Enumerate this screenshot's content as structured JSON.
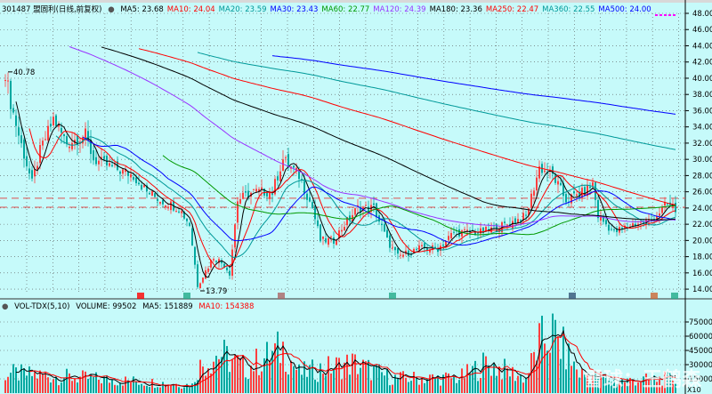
{
  "header": {
    "code_name": "301487 盟固利(日线,前复权)",
    "ma": [
      {
        "label": "MA5: 23.68",
        "color": "#000000"
      },
      {
        "label": "MA10: 24.04",
        "color": "#ff0000"
      },
      {
        "label": "MA20: 23.59",
        "color": "#009999"
      },
      {
        "label": "MA30: 23.43",
        "color": "#0000ff"
      },
      {
        "label": "MA60: 22.77",
        "color": "#009900"
      },
      {
        "label": "MA120: 24.39",
        "color": "#9933ff"
      },
      {
        "label": "MA180: 23.36",
        "color": "#000000"
      },
      {
        "label": "MA250: 22.47",
        "color": "#ff0000"
      },
      {
        "label": "MA360: 22.55",
        "color": "#009999"
      },
      {
        "label": "MA500: 24.00",
        "color": "#0000ff"
      }
    ]
  },
  "volume_header": {
    "title": "VOL-TDX(5,10)",
    "volume": "VOLUME: 99502",
    "ma5": "MA5: 151889",
    "ma10": "MA10: 154388"
  },
  "watermark": "雪球：王鹤森",
  "unit": "X10",
  "chart_data": {
    "type": "candlestick",
    "price_ylim": [
      13,
      49
    ],
    "price_ticks": [
      "48.00",
      "46.00",
      "44.00",
      "42.00",
      "40.00",
      "38.00",
      "36.00",
      "34.00",
      "32.00",
      "30.00",
      "28.00",
      "26.00",
      "24.00",
      "22.00",
      "20.00",
      "18.00",
      "16.00",
      "14.00"
    ],
    "volume_ticks": [
      "75000",
      "60000",
      "45000",
      "30000",
      "15000"
    ],
    "annotations": [
      {
        "text": "40.78",
        "bar": 1,
        "price": 40.78
      },
      {
        "text": "13.79",
        "bar": 72,
        "price": 13.79
      }
    ],
    "ref_lines": [
      25.2,
      24.1
    ],
    "close_anchors": [
      [
        0,
        40.8
      ],
      [
        2,
        37
      ],
      [
        5,
        33
      ],
      [
        10,
        27
      ],
      [
        13,
        31
      ],
      [
        18,
        35
      ],
      [
        23,
        32
      ],
      [
        30,
        33
      ],
      [
        33,
        30
      ],
      [
        40,
        29
      ],
      [
        48,
        28
      ],
      [
        53,
        26
      ],
      [
        58,
        25
      ],
      [
        65,
        24
      ],
      [
        69,
        22
      ],
      [
        72,
        14.5
      ],
      [
        78,
        18
      ],
      [
        82,
        17
      ],
      [
        84,
        16
      ],
      [
        87,
        25
      ],
      [
        93,
        26
      ],
      [
        100,
        26
      ],
      [
        104,
        30
      ],
      [
        110,
        28
      ],
      [
        115,
        24
      ],
      [
        118,
        20
      ],
      [
        123,
        20
      ],
      [
        127,
        22
      ],
      [
        132,
        24
      ],
      [
        138,
        24
      ],
      [
        143,
        20
      ],
      [
        147,
        18
      ],
      [
        155,
        19
      ],
      [
        162,
        19
      ],
      [
        168,
        21
      ],
      [
        178,
        21
      ],
      [
        188,
        22
      ],
      [
        195,
        23
      ],
      [
        200,
        29
      ],
      [
        205,
        28
      ],
      [
        210,
        25
      ],
      [
        217,
        26
      ],
      [
        220,
        27
      ],
      [
        222,
        23
      ],
      [
        228,
        21
      ],
      [
        235,
        22
      ],
      [
        242,
        22.5
      ],
      [
        248,
        24.5
      ],
      [
        251,
        23.7
      ]
    ],
    "volume_anchors": [
      [
        0,
        20000
      ],
      [
        60,
        10000
      ],
      [
        70,
        8000
      ],
      [
        72,
        25000
      ],
      [
        80,
        40000
      ],
      [
        90,
        25000
      ],
      [
        104,
        45000
      ],
      [
        110,
        20000
      ],
      [
        130,
        30000
      ],
      [
        145,
        15000
      ],
      [
        170,
        15000
      ],
      [
        180,
        30000
      ],
      [
        195,
        15000
      ],
      [
        200,
        50000
      ],
      [
        205,
        60000
      ],
      [
        215,
        20000
      ],
      [
        230,
        12000
      ],
      [
        251,
        15000
      ]
    ]
  }
}
